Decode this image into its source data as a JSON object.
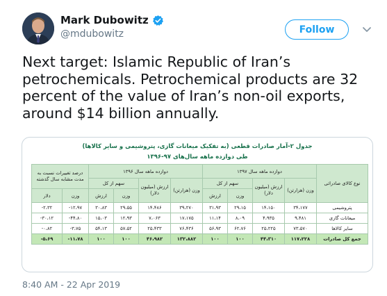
{
  "author": {
    "name": "Mark Dubowitz",
    "handle": "@mdubowitz"
  },
  "follow_label": "Follow",
  "tweet_text": "Next target: Islamic Republic of Iran’s petrochemicals. Petrochemical products are 32 percent of the value of Iran’s non-oil exports, around $14 billion annually.",
  "table": {
    "title_line1": "جدول ۲-آمار صادرات قطعی (به تفکیک میعانات گازی، پتروشیمی و سایر کالاها)",
    "title_line2": "طی دوازده ماهه سال‌های ۹۷-۱۳۹۶",
    "headers": {
      "product": "نوع کالای صادراتی",
      "p1397": "دوازده ماهه سال ۱۳۹۷",
      "p1396": "دوازده ماهه سال ۱۳۹۶",
      "change": "درصد تغییرات نسبت به مدت مشابه سال گذشته",
      "share": "سهم از کل",
      "weight": "وزن (هزارتن)",
      "value": "ارزش (میلیون دلار)",
      "s_value": "ارزش",
      "s_weight": "وزن",
      "c_weight": "وزن",
      "c_dollar": "دلار"
    },
    "rows": [
      {
        "label": "پتروشیمی",
        "w97": "۳۴،۱۷۷",
        "v97": "۱۴،۱۵۰",
        "sw97": "۲۹،۱۵",
        "sv97": "۳۱،۹۳",
        "w96": "۳۹،۲۷۰",
        "v96": "۱۴،۴۸۶",
        "sw96": "۲۹،۵۵",
        "sv96": "۳۰،۸۳",
        "cw": "-۱۲،۹۷",
        "cv": "-۲،۳۲"
      },
      {
        "label": "میعانات گازی",
        "w97": "۹،۴۸۱",
        "v97": "۴،۹۳۵",
        "sw97": "۸،۰۹",
        "sv97": "۱۱،۱۴",
        "w96": "۱۷،۱۷۵",
        "v96": "۷،۰۶۳",
        "sw96": "۱۲،۹۳",
        "sv96": "۱۵،۰۳",
        "cw": "-۴۴،۸۰",
        "cv": "-۳۰،۱۲"
      },
      {
        "label": "سایر کالاها",
        "w97": "۷۳،۵۷۰",
        "v97": "۲۵،۲۲۵",
        "sw97": "۶۲،۷۶",
        "sv97": "۵۶،۹۳",
        "w96": "۷۶،۴۳۶",
        "v96": "۲۵،۴۳۳",
        "sw96": "۵۷،۵۲",
        "sv96": "۵۴،۱۳",
        "cw": "-۳،۷۵",
        "cv": "-۰،۸۲"
      }
    ],
    "total": {
      "label": "جمع کل صادرات",
      "w97": "۱۱۷،۲۲۸",
      "v97": "۴۴،۳۱۰",
      "sw97": "۱۰۰",
      "sv97": "۱۰۰",
      "w96": "۱۳۲،۸۸۲",
      "v96": "۴۶،۹۸۲",
      "sw96": "۱۰۰",
      "sv96": "۱۰۰",
      "cw": "-۱۱،۷۸",
      "cv": "-۵،۶۹"
    }
  },
  "timestamp": "8:40 AM - 22 Apr 2019",
  "colors": {
    "accent": "#1da1f2",
    "table_header": "#cfe8cf",
    "table_total": "#c3e7b6",
    "table_title": "#16704a"
  },
  "icons": [
    "verified-badge-icon",
    "chevron-down-icon"
  ]
}
